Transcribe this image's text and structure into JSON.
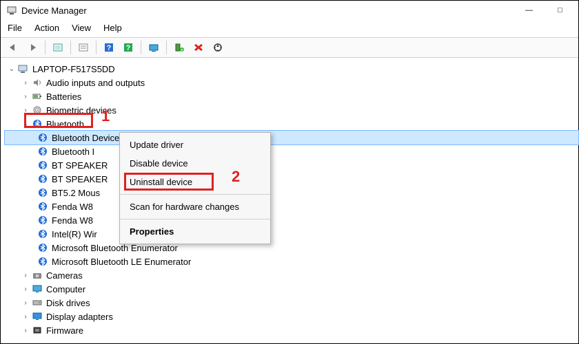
{
  "window": {
    "title": "Device Manager",
    "controls": {
      "min": "—",
      "max": "□",
      "close": "✕"
    }
  },
  "menu": {
    "file": "File",
    "action": "Action",
    "view": "View",
    "help": "Help"
  },
  "toolbar": {
    "back": "back",
    "forward": "forward",
    "show_hidden": "show-hidden",
    "properties": "properties",
    "help": "help",
    "help2": "help",
    "update": "update",
    "add": "add-legacy",
    "remove": "remove",
    "scan": "scan"
  },
  "tree": {
    "root": "LAPTOP-F517S5DD",
    "categories": [
      {
        "label": "Audio inputs and outputs",
        "expanded": false,
        "icon": "audio"
      },
      {
        "label": "Batteries",
        "expanded": false,
        "icon": "battery"
      },
      {
        "label": "Biometric devices",
        "expanded": false,
        "icon": "biometric"
      },
      {
        "label": "Bluetooth",
        "expanded": true,
        "icon": "bluetooth",
        "children": [
          {
            "label": "Bluetooth Device (RFCOMM Protocol TDI)",
            "selected": true
          },
          {
            "label": "Bluetooth I"
          },
          {
            "label": "BT SPEAKER"
          },
          {
            "label": "BT SPEAKER"
          },
          {
            "label": "BT5.2 Mous"
          },
          {
            "label": "Fenda W8"
          },
          {
            "label": "Fenda W8"
          },
          {
            "label": "Intel(R) Wir"
          },
          {
            "label": "Microsoft Bluetooth Enumerator"
          },
          {
            "label": "Microsoft Bluetooth LE Enumerator"
          }
        ]
      },
      {
        "label": "Cameras",
        "expanded": false,
        "icon": "camera"
      },
      {
        "label": "Computer",
        "expanded": false,
        "icon": "computer"
      },
      {
        "label": "Disk drives",
        "expanded": false,
        "icon": "disk"
      },
      {
        "label": "Display adapters",
        "expanded": false,
        "icon": "display"
      },
      {
        "label": "Firmware",
        "expanded": false,
        "icon": "firmware"
      }
    ]
  },
  "context_menu": {
    "items": [
      {
        "label": "Update driver",
        "key": "update"
      },
      {
        "label": "Disable device",
        "key": "disable"
      },
      {
        "label": "Uninstall device",
        "key": "uninstall"
      },
      {
        "sep": true
      },
      {
        "label": "Scan for hardware changes",
        "key": "scan"
      },
      {
        "sep": true
      },
      {
        "label": "Properties",
        "key": "props",
        "bold": true
      }
    ]
  },
  "annotations": {
    "one": "1",
    "two": "2"
  }
}
